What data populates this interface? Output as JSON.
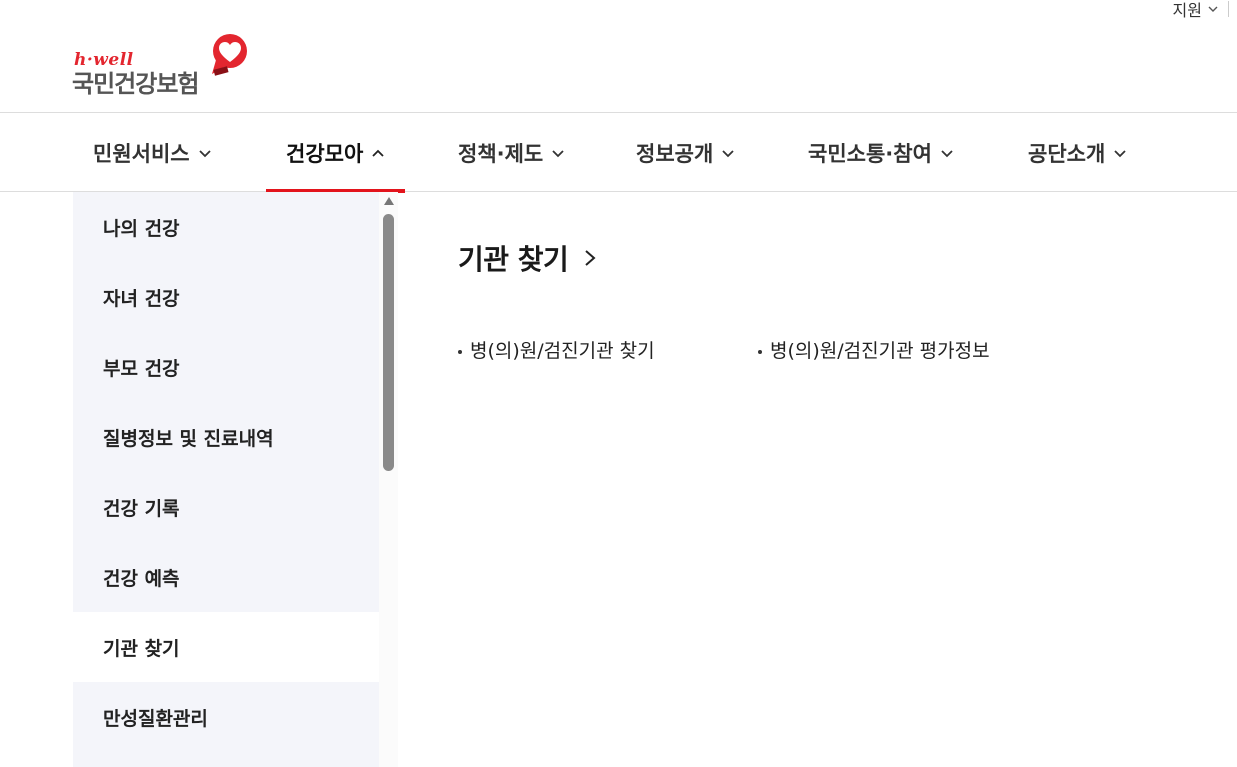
{
  "utility": {
    "support_label": "지원"
  },
  "logo": {
    "tagline": "h·well",
    "brand": "국민건강보험"
  },
  "gnb": {
    "items": [
      {
        "label": "민원서비스",
        "active": false
      },
      {
        "label": "건강모아",
        "active": true
      },
      {
        "label": "정책·제도",
        "active": false
      },
      {
        "label": "정보공개",
        "active": false
      },
      {
        "label": "국민소통·참여",
        "active": false
      },
      {
        "label": "공단소개",
        "active": false
      }
    ]
  },
  "sidebar": {
    "items": [
      {
        "label": "나의 건강"
      },
      {
        "label": "자녀 건강"
      },
      {
        "label": "부모 건강"
      },
      {
        "label": "질병정보 및 진료내역"
      },
      {
        "label": "건강 기록"
      },
      {
        "label": "건강 예측"
      },
      {
        "label": "기관 찾기",
        "active": true
      },
      {
        "label": "만성질환관리"
      }
    ]
  },
  "content": {
    "title": "기관 찾기",
    "links": [
      {
        "label": "병(의)원/검진기관 찾기"
      },
      {
        "label": "병(의)원/검진기관 평가정보"
      }
    ]
  },
  "colors": {
    "accent": "#e3141c",
    "sidebar_bg": "#f4f5fa",
    "brand_gray": "#555555"
  }
}
